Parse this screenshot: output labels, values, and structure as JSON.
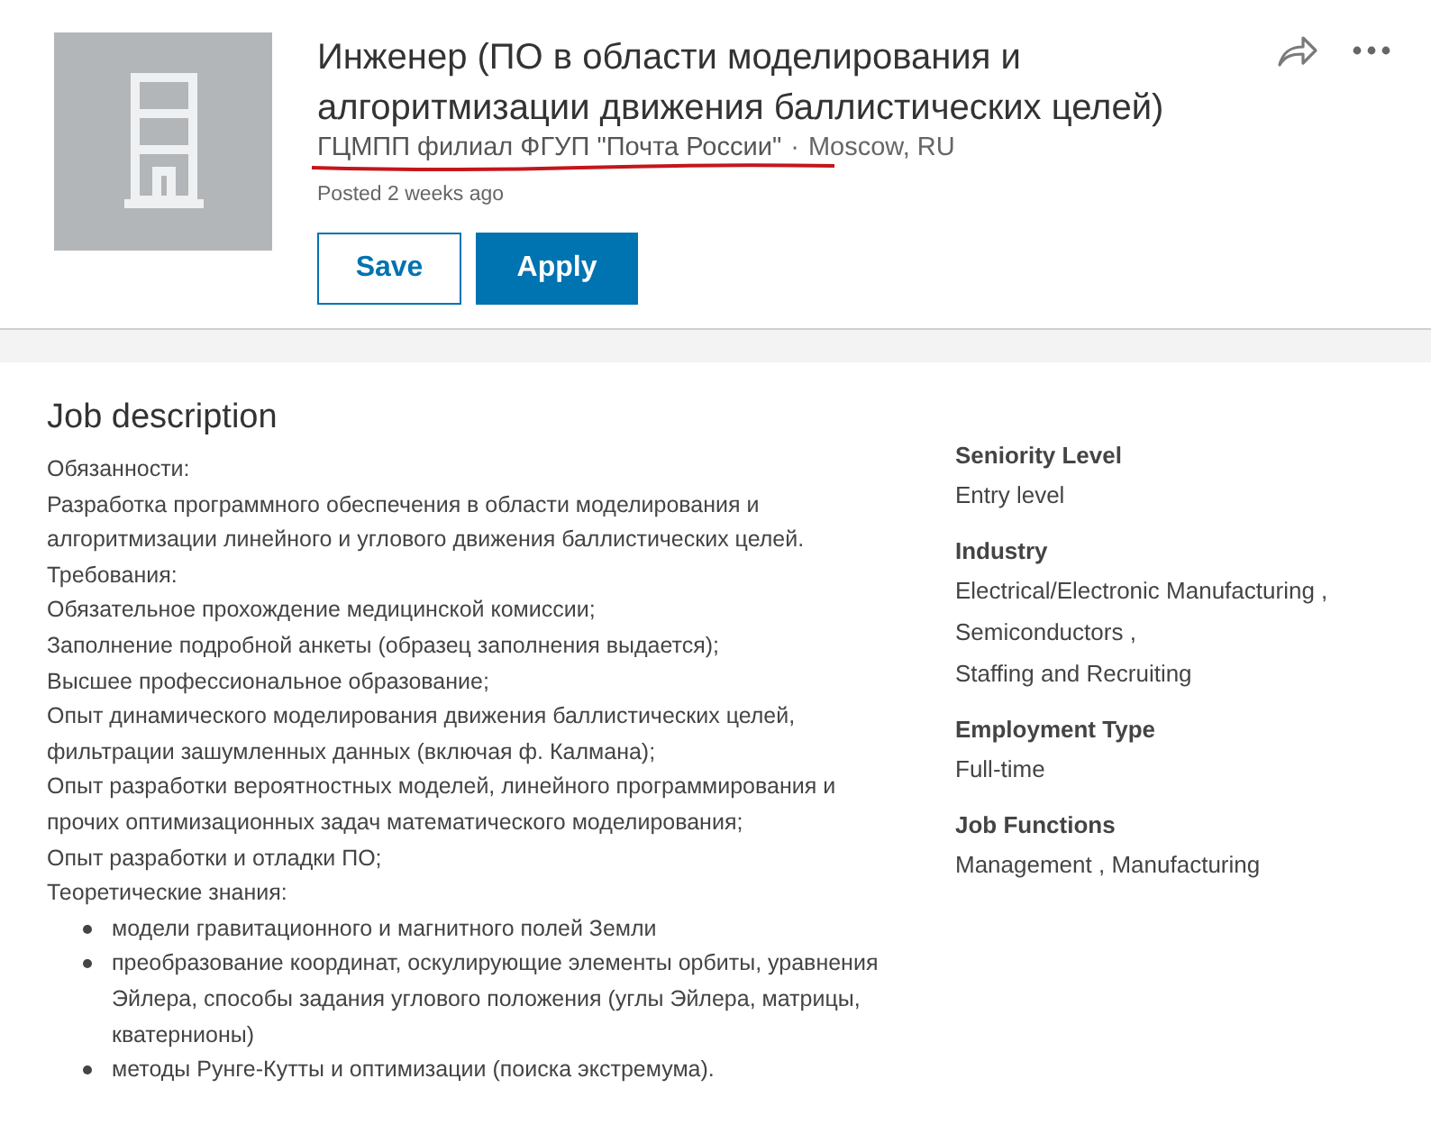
{
  "job": {
    "title": "Инженер (ПО в области моделирования и алгоритмизации движения баллистических целей)",
    "company": "ГЦМПП филиал ФГУП \"Почта России\"",
    "separator": "·",
    "location": "Moscow, RU",
    "posted": "Posted 2 weeks ago",
    "buttons": [
      {
        "label": "Save",
        "kind": "secondary"
      },
      {
        "label": "Apply",
        "kind": "primary"
      }
    ]
  },
  "description": {
    "heading": "Job description",
    "lines": [
      {
        "kind": "text",
        "text": "Обязанности:"
      },
      {
        "kind": "text",
        "text": "Разработка программного обеспечения в области моделирования и алгоритмизации линейного и углового движения баллистических целей."
      },
      {
        "kind": "text",
        "text": "Требования:"
      },
      {
        "kind": "text",
        "text": "Обязательное прохождение медицинской комиссии;"
      },
      {
        "kind": "text",
        "text": "Заполнение подробной анкеты (образец заполнения выдается);"
      },
      {
        "kind": "text",
        "text": "Высшее профессиональное образование;"
      },
      {
        "kind": "text",
        "text": "Опыт динамического моделирования движения баллистических целей, фильтрации зашумленных данных (включая ф. Калмана);"
      },
      {
        "kind": "text",
        "text": "Опыт разработки вероятностных моделей, линейного программирования и прочих оптимизационных задач математического моделирования;"
      },
      {
        "kind": "text",
        "text": "Опыт разработки и отладки ПО;"
      },
      {
        "kind": "text",
        "text": "Теоретические знания:"
      },
      {
        "kind": "bullet",
        "text": "модели гравитационного и магнитного полей Земли"
      },
      {
        "kind": "bullet",
        "text": "преобразование координат, оскулирующие элементы орбиты, уравнения Эйлера, способы задания углового положения (углы Эйлера, матрицы, кватернионы)"
      },
      {
        "kind": "bullet",
        "text": "методы Рунге-Кутты и оптимизации (поиска экстремума)."
      }
    ]
  },
  "criteria": [
    {
      "label": "Seniority Level",
      "values": [
        "Entry level"
      ]
    },
    {
      "label": "Industry",
      "values": [
        "Electrical/Electronic Manufacturing ,",
        "Semiconductors ,",
        "Staffing and Recruiting"
      ]
    },
    {
      "label": "Employment Type",
      "values": [
        "Full-time"
      ]
    },
    {
      "label": "Job Functions",
      "values": [
        "Management , Manufacturing"
      ]
    }
  ]
}
